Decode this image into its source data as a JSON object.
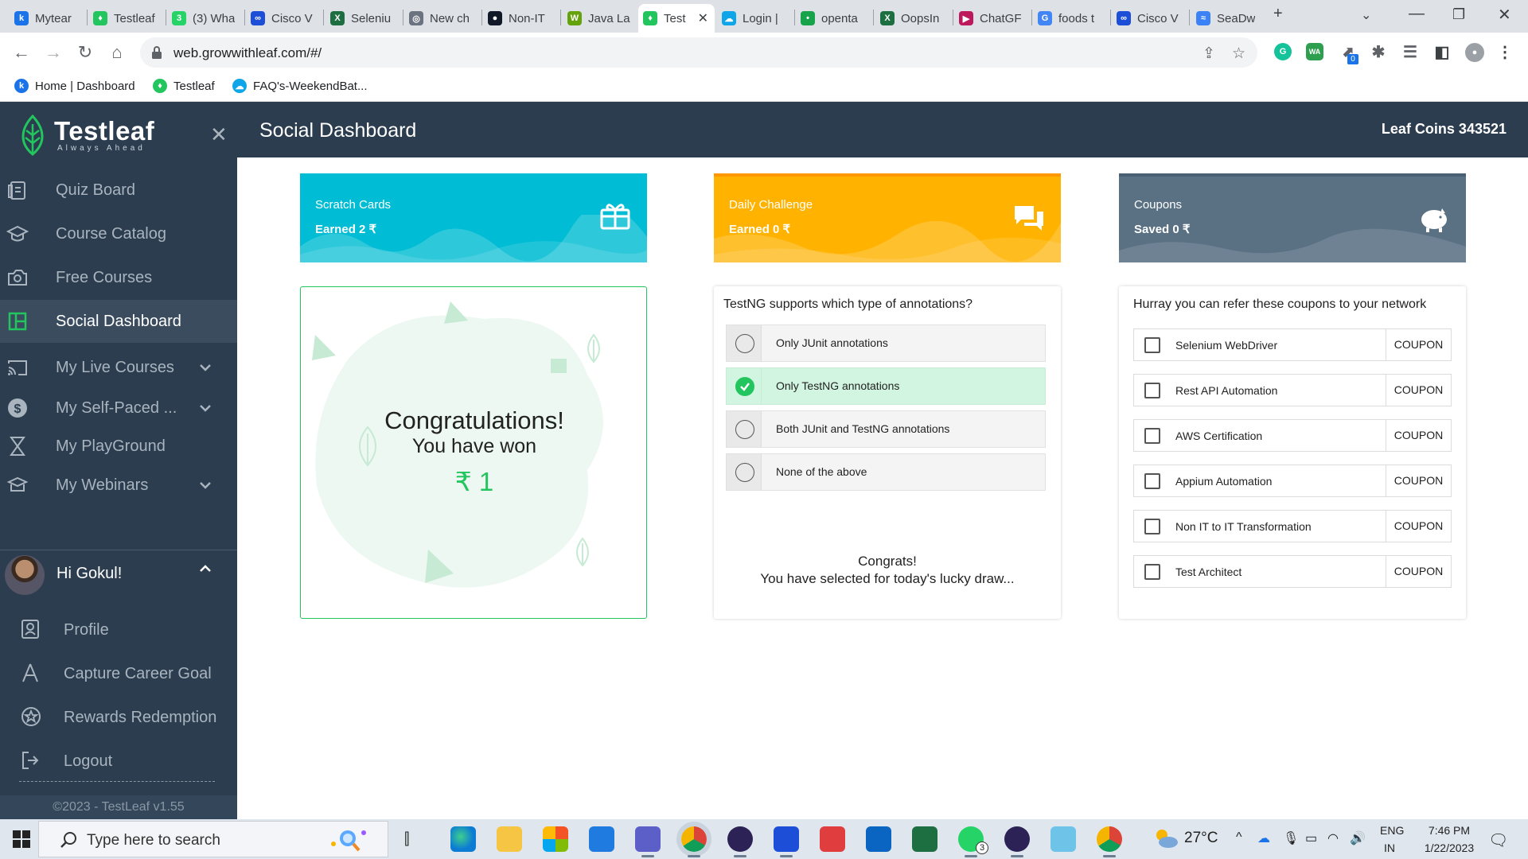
{
  "browser": {
    "tabs": [
      {
        "label": "Mytear",
        "color": "#1a73e8",
        "glyph": "k"
      },
      {
        "label": "Testleaf",
        "color": "#22c55e",
        "glyph": "♦"
      },
      {
        "label": "(3) Wha",
        "color": "#25d366",
        "glyph": "3"
      },
      {
        "label": "Cisco V",
        "color": "#1d4ed8",
        "glyph": "∞"
      },
      {
        "label": "Seleniu",
        "color": "#1d6f42",
        "glyph": "X"
      },
      {
        "label": "New ch",
        "color": "#6b7280",
        "glyph": "◎"
      },
      {
        "label": "Non-IT",
        "color": "#111827",
        "glyph": "●"
      },
      {
        "label": "Java La",
        "color": "#65a30d",
        "glyph": "W"
      },
      {
        "label": "Test",
        "color": "#22c55e",
        "glyph": "♦"
      },
      {
        "label": "Login |",
        "color": "#0ea5e9",
        "glyph": "☁"
      },
      {
        "label": "openta",
        "color": "#16a34a",
        "glyph": "•"
      },
      {
        "label": "OopsIn",
        "color": "#1d6f42",
        "glyph": "X"
      },
      {
        "label": "ChatGF",
        "color": "#be185d",
        "glyph": "▶"
      },
      {
        "label": "foods t",
        "color": "#4285f4",
        "glyph": "G"
      },
      {
        "label": "Cisco V",
        "color": "#1d4ed8",
        "glyph": "∞"
      },
      {
        "label": "SeaDw",
        "color": "#3b82f6",
        "glyph": "≈"
      }
    ],
    "new_tab": "+",
    "url": "web.growwithleaf.com/#/",
    "bookmarks": [
      {
        "label": "Home | Dashboard",
        "color": "#1a73e8",
        "glyph": "k"
      },
      {
        "label": "Testleaf",
        "color": "#22c55e",
        "glyph": "♦"
      },
      {
        "label": "FAQ's-WeekendBat...",
        "color": "#0ea5e9",
        "glyph": "☁"
      }
    ],
    "extension_badge": "0",
    "ext_wa": "WA"
  },
  "sidebar": {
    "brand": "Testleaf",
    "tagline": "Always Ahead",
    "items": [
      {
        "label": "Quiz Board",
        "icon": "quiz-icon"
      },
      {
        "label": "Course Catalog",
        "icon": "graduation-cap-icon"
      },
      {
        "label": "Free Courses",
        "icon": "free-courses-icon"
      },
      {
        "label": "Social Dashboard",
        "icon": "dashboard-icon",
        "active": true
      },
      {
        "label": "My Live Courses",
        "icon": "cast-icon"
      },
      {
        "label": "My Self-Paced ...",
        "icon": "dollar-icon"
      },
      {
        "label": "My PlayGround",
        "icon": "playground-icon"
      },
      {
        "label": "My Webinars",
        "icon": "webinar-icon"
      }
    ],
    "user_greeting": "Hi Gokul!",
    "user_items": [
      {
        "label": "Profile",
        "icon": "profile-icon"
      },
      {
        "label": "Capture Career Goal",
        "icon": "career-goal-icon"
      },
      {
        "label": "Rewards Redemption",
        "icon": "rewards-icon"
      },
      {
        "label": "Logout",
        "icon": "logout-icon"
      }
    ],
    "footer": "©2023 - TestLeaf v1.55"
  },
  "header": {
    "title": "Social Dashboard",
    "leaf_coins": "Leaf Coins 343521"
  },
  "cards": [
    {
      "title": "Scratch Cards",
      "value": "Earned 2 ₹",
      "color": "#00bcd4",
      "icon": "gift-icon"
    },
    {
      "title": "Daily Challenge",
      "value": "Earned 0 ₹",
      "color": "#ffb300",
      "icon": "chat-icon"
    },
    {
      "title": "Coupons",
      "value": "Saved 0 ₹",
      "color": "#5a7184",
      "icon": "piggy-bank-icon"
    }
  ],
  "scratch": {
    "title": "Congratulations!",
    "subtitle": "You have won",
    "amount": "₹ 1"
  },
  "quiz": {
    "question": "TestNG supports which type of annotations?",
    "options": [
      {
        "label": "Only JUnit annotations",
        "selected": false
      },
      {
        "label": "Only TestNG annotations",
        "selected": true
      },
      {
        "label": "Both JUnit and TestNG annotations",
        "selected": false
      },
      {
        "label": "None of the above",
        "selected": false
      }
    ],
    "message_line1": "Congrats!",
    "message_line2": "You have selected for today's lucky draw..."
  },
  "coupons": {
    "heading": "Hurray you can refer these coupons to your network",
    "button_label": "COUPON",
    "items": [
      "Selenium WebDriver",
      "Rest API Automation",
      "AWS Certification",
      "Appium Automation",
      "Non IT to IT Transformation",
      "Test Architect"
    ]
  },
  "taskbar": {
    "search_placeholder": "Type here to search",
    "weather": "27°C",
    "lang_line1": "ENG",
    "lang_line2": "IN",
    "time": "7:46 PM",
    "date": "1/22/2023",
    "whatsapp_badge": "3"
  }
}
